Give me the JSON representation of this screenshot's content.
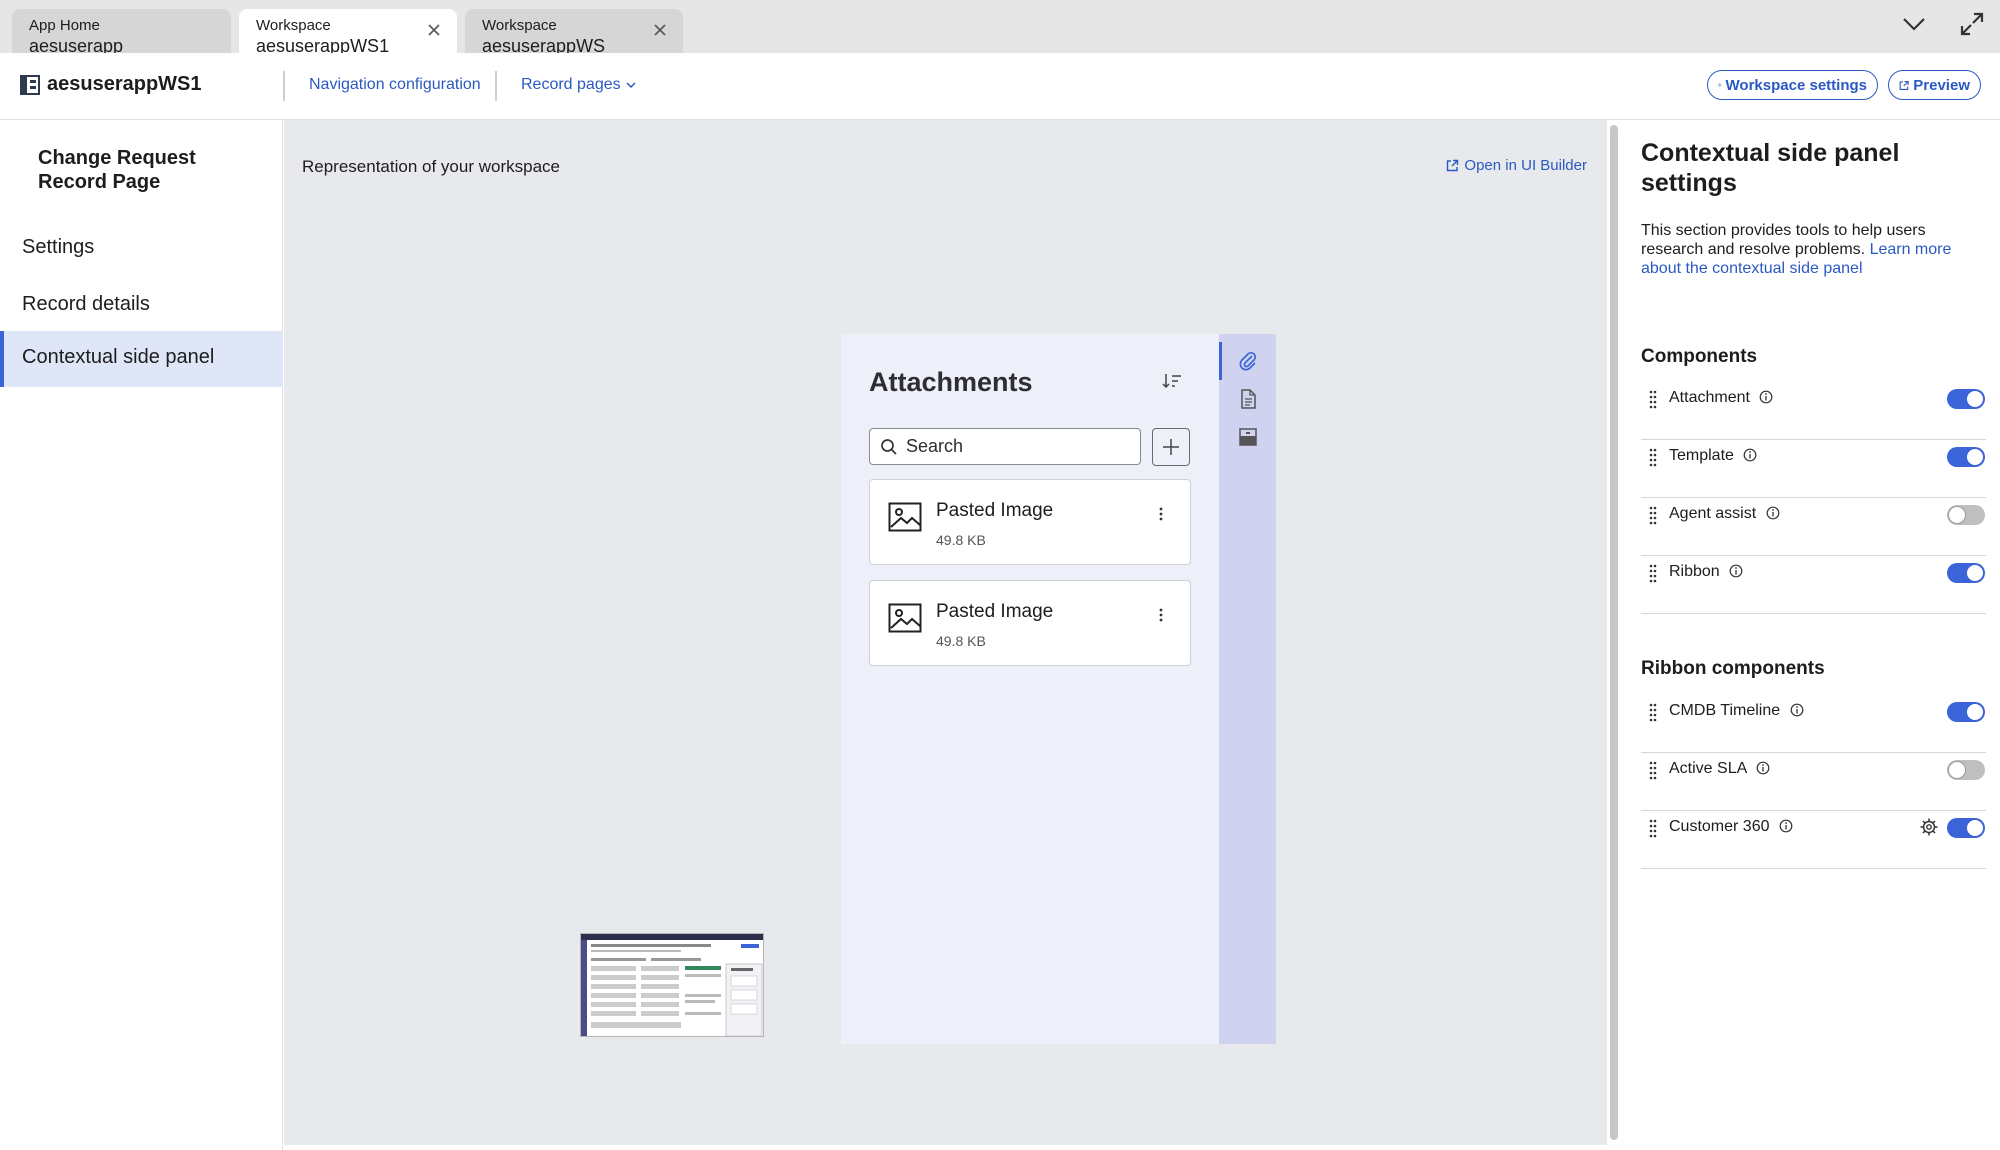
{
  "tabs": [
    {
      "line1": "App Home",
      "line2": "aesuserapp",
      "active": false
    },
    {
      "line1": "Workspace",
      "line2": "aesuserappWS1",
      "active": true
    },
    {
      "line1": "Workspace",
      "line2": "aesuserappWS",
      "active": false
    }
  ],
  "header": {
    "app_title": "aesuserappWS1",
    "nav_configuration": "Navigation configuration",
    "record_pages": "Record pages",
    "workspace_settings": "Workspace settings",
    "preview": "Preview"
  },
  "leftnav": {
    "page_title": "Change Request Record Page",
    "items": [
      {
        "label": "Settings",
        "selected": false
      },
      {
        "label": "Record details",
        "selected": false
      },
      {
        "label": "Contextual side panel",
        "selected": true
      }
    ]
  },
  "canvas": {
    "representation": "Representation of your workspace",
    "open_ui_builder": "Open in UI Builder"
  },
  "attachments": {
    "title": "Attachments",
    "search_placeholder": "Search",
    "items": [
      {
        "name": "Pasted Image",
        "size": "49.8 KB"
      },
      {
        "name": "Pasted Image",
        "size": "49.8 KB"
      }
    ]
  },
  "settings": {
    "title": "Contextual side panel settings",
    "description": "This section provides tools to help users research and resolve problems. ",
    "learn_more": "Learn more about the contextual side panel",
    "components_heading": "Components",
    "components": [
      {
        "label": "Attachment",
        "enabled": true
      },
      {
        "label": "Template",
        "enabled": true
      },
      {
        "label": "Agent assist",
        "enabled": false
      },
      {
        "label": "Ribbon",
        "enabled": true
      }
    ],
    "ribbon_heading": "Ribbon components",
    "ribbon_components": [
      {
        "label": "CMDB Timeline",
        "enabled": true
      },
      {
        "label": "Active SLA",
        "enabled": false
      },
      {
        "label": "Customer 360",
        "enabled": true,
        "has_settings": true
      }
    ]
  },
  "colors": {
    "accent": "#3a64d8",
    "link": "#2b59c3",
    "canvas_bg": "#e8e9ec",
    "selected_nav": "#dfe6f8"
  }
}
